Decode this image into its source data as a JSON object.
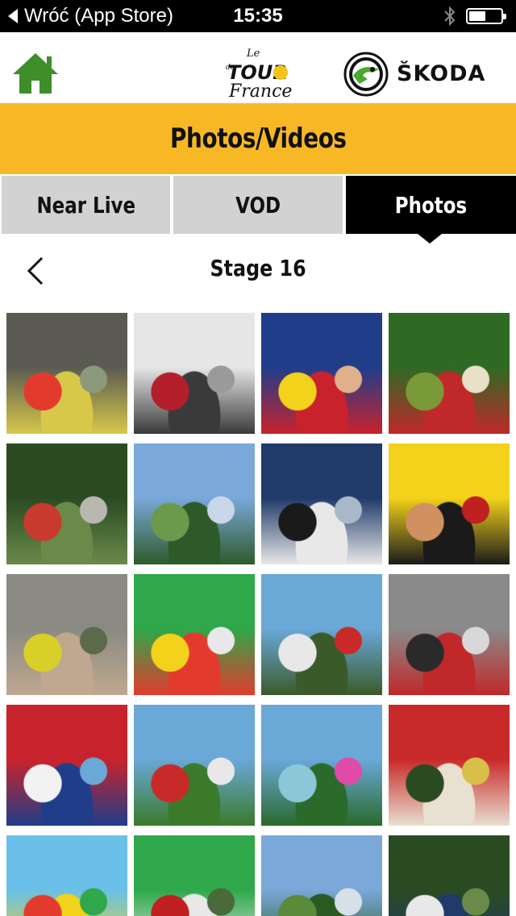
{
  "status_bar": {
    "back_label": "Wróć (App Store)",
    "time": "15:35",
    "icons": [
      "bluetooth-icon",
      "battery-icon"
    ]
  },
  "header": {
    "home_icon": "home-icon",
    "tour_logo_text": [
      "Le",
      "TOUR",
      "de",
      "France"
    ],
    "sponsor_name": "ŠKODA"
  },
  "page_title": "Photos/Videos",
  "tabs": [
    {
      "label": "Near Live",
      "active": false
    },
    {
      "label": "VOD",
      "active": false
    },
    {
      "label": "Photos",
      "active": true
    }
  ],
  "stage": {
    "back_icon": "chevron-left-icon",
    "title": "Stage 16"
  },
  "colors": {
    "accent_yellow": "#f8b826",
    "tab_inactive": "#d2d2d2",
    "tab_active": "#000000",
    "home_green": "#3e8e2a",
    "skoda_green": "#4ba82e"
  },
  "photos": [
    {
      "name": "sprint-finish-vittel",
      "palette": [
        "#5a5a52",
        "#d8c84a",
        "#e23b2e",
        "#8a9a7a"
      ]
    },
    {
      "name": "photo-finish-bikes",
      "palette": [
        "#e6e6e6",
        "#3a3a3a",
        "#b21f2a",
        "#9a9a9a"
      ]
    },
    {
      "name": "british-fans-flags",
      "palette": [
        "#203d8a",
        "#c8232c",
        "#f2d21a",
        "#e0b08a"
      ]
    },
    {
      "name": "red-bus-trees",
      "palette": [
        "#2f6a24",
        "#c0282a",
        "#7a9a3a",
        "#e8e0c8"
      ]
    },
    {
      "name": "peloton-forest",
      "palette": [
        "#2a4a22",
        "#6a8a4a",
        "#c83a2e",
        "#b8b8b0"
      ]
    },
    {
      "name": "mountain-landscape",
      "palette": [
        "#7aa8d8",
        "#2e5a2a",
        "#6a9a4a",
        "#c8d8e8"
      ]
    },
    {
      "name": "rider-close-up",
      "palette": [
        "#203a6a",
        "#e8e8e8",
        "#1a1a1a",
        "#a8b8c8"
      ]
    },
    {
      "name": "yellow-jersey-portrait",
      "palette": [
        "#f2d21a",
        "#1a1a1a",
        "#d09060",
        "#c02020"
      ]
    },
    {
      "name": "village-street-crowd",
      "palette": [
        "#8a8a82",
        "#c0a890",
        "#d8d028",
        "#5a6a4a"
      ]
    },
    {
      "name": "green-jersey-flowers",
      "palette": [
        "#2ea84a",
        "#e23b2e",
        "#f2d21a",
        "#e8e8e8"
      ]
    },
    {
      "name": "road-riders-cliff",
      "palette": [
        "#6aa8d8",
        "#3a5a2a",
        "#e8e8e8",
        "#c82a2a"
      ]
    },
    {
      "name": "peloton-wall",
      "palette": [
        "#8a8a8a",
        "#c0282a",
        "#2a2a2a",
        "#d8d8d8"
      ]
    },
    {
      "name": "norwegian-fans",
      "palette": [
        "#c8232c",
        "#203d8a",
        "#f2f2f2",
        "#6aa8d8"
      ]
    },
    {
      "name": "grass-hill-banner",
      "palette": [
        "#6aa8d8",
        "#3a7a2a",
        "#c82a2a",
        "#e8e8e8"
      ]
    },
    {
      "name": "castle-motion-blur",
      "palette": [
        "#6aa8d8",
        "#2a6a2a",
        "#8ac8d8",
        "#e04aa8"
      ]
    },
    {
      "name": "crowd-climb",
      "palette": [
        "#c82a2a",
        "#e8e0d0",
        "#2a4a22",
        "#d8c048"
      ]
    },
    {
      "name": "yellow-bike-decor",
      "palette": [
        "#6ac0e8",
        "#f2d21a",
        "#e23b2e",
        "#2ea84a"
      ]
    },
    {
      "name": "green-jersey-celebration",
      "palette": [
        "#2ea84a",
        "#e8e8e8",
        "#c02020",
        "#4a6a3a"
      ]
    },
    {
      "name": "forest-valley",
      "palette": [
        "#7aa8d8",
        "#2a5a22",
        "#5a8a3a",
        "#d8e0e8"
      ]
    },
    {
      "name": "climbers-trees",
      "palette": [
        "#2a4a22",
        "#203a6a",
        "#e8e8e8",
        "#6a8a4a"
      ]
    }
  ]
}
